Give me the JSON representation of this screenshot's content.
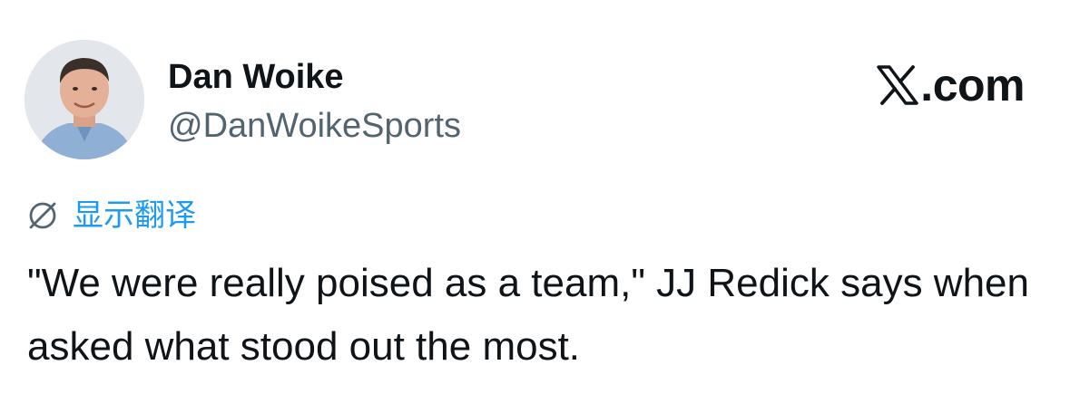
{
  "author": {
    "display_name": "Dan Woike",
    "handle": "@DanWoikeSports",
    "avatar_icon": "profile-photo"
  },
  "brand": {
    "logo_icon": "x-logo-icon",
    "text": ".com"
  },
  "translate": {
    "icon": "globe-icon",
    "label": "显示翻译",
    "color": "#1d9bf0"
  },
  "tweet": {
    "text": "\"We were really poised as a team,\" JJ Redick says when asked what stood out the most."
  },
  "colors": {
    "text_primary": "#0f1419",
    "text_secondary": "#536471",
    "link": "#1d9bf0",
    "background": "#ffffff"
  }
}
